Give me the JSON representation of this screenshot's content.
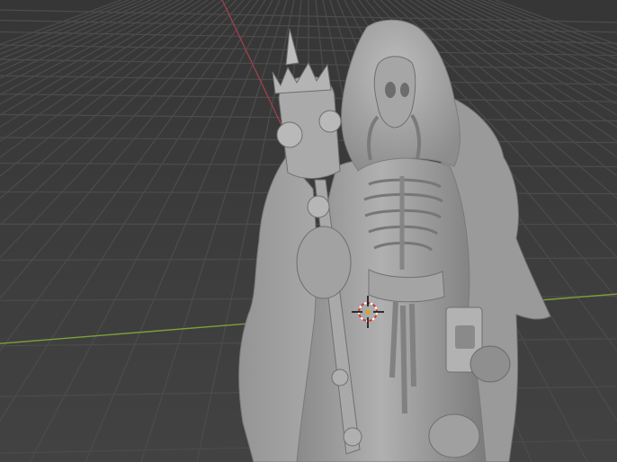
{
  "viewport": {
    "mode": "3d-viewport-solid",
    "background_color": "#3d3d3d",
    "grid_color": "#4a4a4a",
    "x_axis_color": "#7a9a3b",
    "y_axis_color": "#9a3f4a",
    "model_color": "#9c9c9c",
    "model_shadow_color": "#6e6e6e",
    "model_highlight_color": "#c4c4c4",
    "cursor_icon": "3d-cursor-icon"
  },
  "scene": {
    "object": "hooded-skeleton-wizard-with-staff"
  }
}
